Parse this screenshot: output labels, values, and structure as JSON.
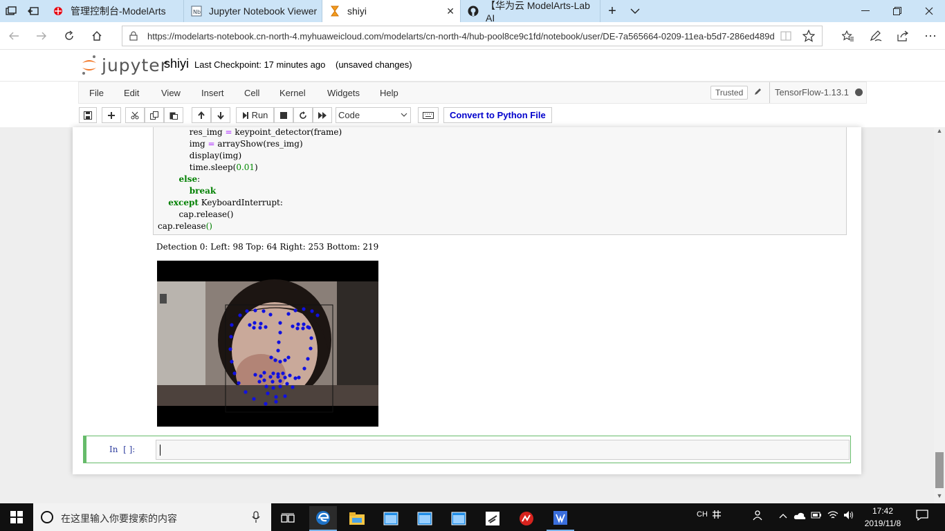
{
  "browser": {
    "tabs": [
      {
        "label": "管理控制台-ModelArts"
      },
      {
        "label": "Jupyter Notebook Viewer"
      },
      {
        "label": "shiyi"
      },
      {
        "label": "【华为云 ModelArts-Lab AI"
      }
    ],
    "url": "https://modelarts-notebook.cn-north-4.myhuaweicloud.com/modelarts/cn-north-4/hub-pool8ce9c1fd/notebook/user/DE-7a565664-0209-11ea-b5d7-286ed489d"
  },
  "jupyter": {
    "logo_text": "jupyter",
    "notebook_name": "shiyi",
    "checkpoint": "Last Checkpoint: 17 minutes ago",
    "unsaved": "(unsaved changes)",
    "menu": [
      "File",
      "Edit",
      "View",
      "Insert",
      "Cell",
      "Kernel",
      "Widgets",
      "Help"
    ],
    "trusted": "Trusted",
    "kernel": "TensorFlow-1.13.1",
    "toolbar": {
      "run_label": "Run",
      "cell_type": "Code",
      "convert_label": "Convert to Python File"
    }
  },
  "cell": {
    "code_lines": [
      {
        "indent": "            ",
        "parts": [
          {
            "t": "res_img ",
            "c": ""
          },
          {
            "t": "=",
            "c": "op"
          },
          {
            "t": " keypoint_detector(frame)",
            "c": ""
          }
        ]
      },
      {
        "indent": "            ",
        "parts": [
          {
            "t": "img ",
            "c": ""
          },
          {
            "t": "=",
            "c": "op"
          },
          {
            "t": " arrayShow(res_img)",
            "c": ""
          }
        ]
      },
      {
        "indent": "            ",
        "parts": [
          {
            "t": "display(img)",
            "c": ""
          }
        ]
      },
      {
        "indent": "            ",
        "parts": [
          {
            "t": "time.sleep(",
            "c": ""
          },
          {
            "t": "0.01",
            "c": "num"
          },
          {
            "t": ")",
            "c": ""
          }
        ]
      },
      {
        "indent": "        ",
        "parts": [
          {
            "t": "else",
            "c": "kw"
          },
          {
            "t": ":",
            "c": ""
          }
        ]
      },
      {
        "indent": "            ",
        "parts": [
          {
            "t": "break",
            "c": "kw"
          }
        ]
      },
      {
        "indent": "    ",
        "parts": [
          {
            "t": "except",
            "c": "kw"
          },
          {
            "t": " KeyboardInterrupt:",
            "c": ""
          }
        ]
      },
      {
        "indent": "        ",
        "parts": [
          {
            "t": "cap.release()",
            "c": ""
          }
        ]
      },
      {
        "indent": "",
        "parts": [
          {
            "t": "cap.release",
            "c": ""
          },
          {
            "t": "()",
            "c": "paren"
          }
        ]
      }
    ],
    "output_text": "Detection 0: Left: 98 Top: 64 Right: 253 Bottom: 219"
  },
  "empty_cell": {
    "prompt": "In  [ ]:"
  },
  "taskbar": {
    "search_placeholder": "在这里输入你要搜索的内容",
    "ime": "CH",
    "time": "17:42",
    "date": "2019/11/8"
  }
}
